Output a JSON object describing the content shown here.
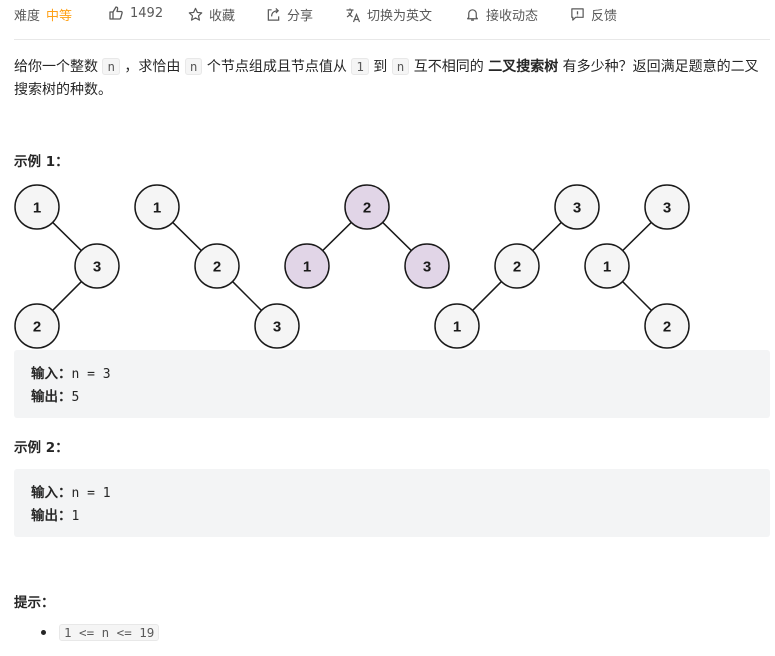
{
  "toolbar": {
    "difficulty_label": "难度",
    "difficulty_value": "中等",
    "likes": "1492",
    "collect": "收藏",
    "share": "分享",
    "switch_lang": "切换为英文",
    "notify": "接收动态",
    "feedback": "反馈"
  },
  "colors": {
    "difficulty": "#ffa116",
    "highlight_node": "#e1d5e7",
    "plain_node": "#f5f5f5"
  },
  "description": {
    "p1": "给你一个整数 ",
    "c1": "n",
    "p2": " ，求恰由 ",
    "c2": "n",
    "p3": " 个节点组成且节点值从 ",
    "c3": "1",
    "p4": " 到 ",
    "c4": "n",
    "p5": " 互不相同的 ",
    "bold": "二叉搜索树",
    "p6": " 有多少种？返回满足题意的二叉搜索树的种数。"
  },
  "example1": {
    "title": "示例 1：",
    "input_label": "输入：",
    "input_value": "n = 3",
    "output_label": "输出：",
    "output_value": "5"
  },
  "trees": [
    {
      "nodes": [
        "1",
        "3",
        "2"
      ],
      "highlight": false
    },
    {
      "nodes": [
        "1",
        "2",
        "3"
      ],
      "highlight": false
    },
    {
      "nodes": [
        "2",
        "1",
        "3"
      ],
      "highlight": true
    },
    {
      "nodes": [
        "3",
        "2",
        "1"
      ],
      "highlight": false
    },
    {
      "nodes": [
        "3",
        "1",
        "2"
      ],
      "highlight": false
    }
  ],
  "example2": {
    "title": "示例 2：",
    "input_label": "输入：",
    "input_value": "n = 1",
    "output_label": "输出：",
    "output_value": "1"
  },
  "hints": {
    "title": "提示：",
    "items": [
      "1 <= n <= 19"
    ]
  }
}
